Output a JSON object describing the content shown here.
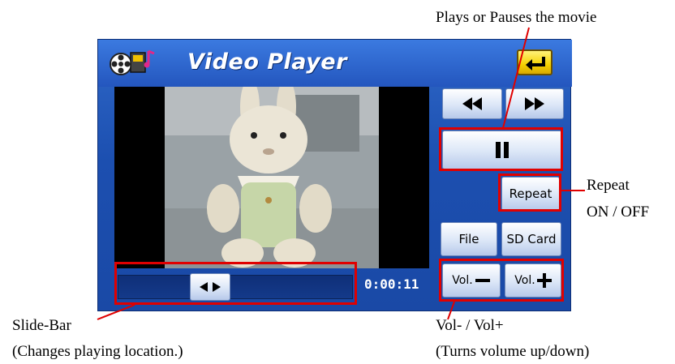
{
  "app": {
    "title": "Video Player"
  },
  "controls": {
    "repeat_label": "Repeat",
    "file_label": "File",
    "sdcard_label": "SD Card",
    "vol_down_label": "Vol.",
    "vol_up_label": "Vol."
  },
  "seek": {
    "time": "0:00:11",
    "position_fraction": 0.37
  },
  "annotations": {
    "play_pause": "Plays or Pauses the movie",
    "repeat_line1": "Repeat",
    "repeat_line2": "ON / OFF",
    "slidebar_line1": "Slide-Bar",
    "slidebar_line2": "(Changes playing location.)",
    "vol_line1": "Vol- / Vol+",
    "vol_line2": "(Turns volume up/down)"
  },
  "icons": {
    "app_icon": "film-reel-icon",
    "back": "return-arrow-icon",
    "rewind": "rewind-icon",
    "fast_forward": "fast-forward-icon",
    "pause": "pause-icon",
    "seek_thumb": "left-right-arrows-icon",
    "minus": "minus-icon",
    "plus": "plus-icon"
  },
  "colors": {
    "highlight": "#e00000",
    "screen_blue": "#1c4fb0",
    "back_button_yellow": "#f5d100"
  }
}
